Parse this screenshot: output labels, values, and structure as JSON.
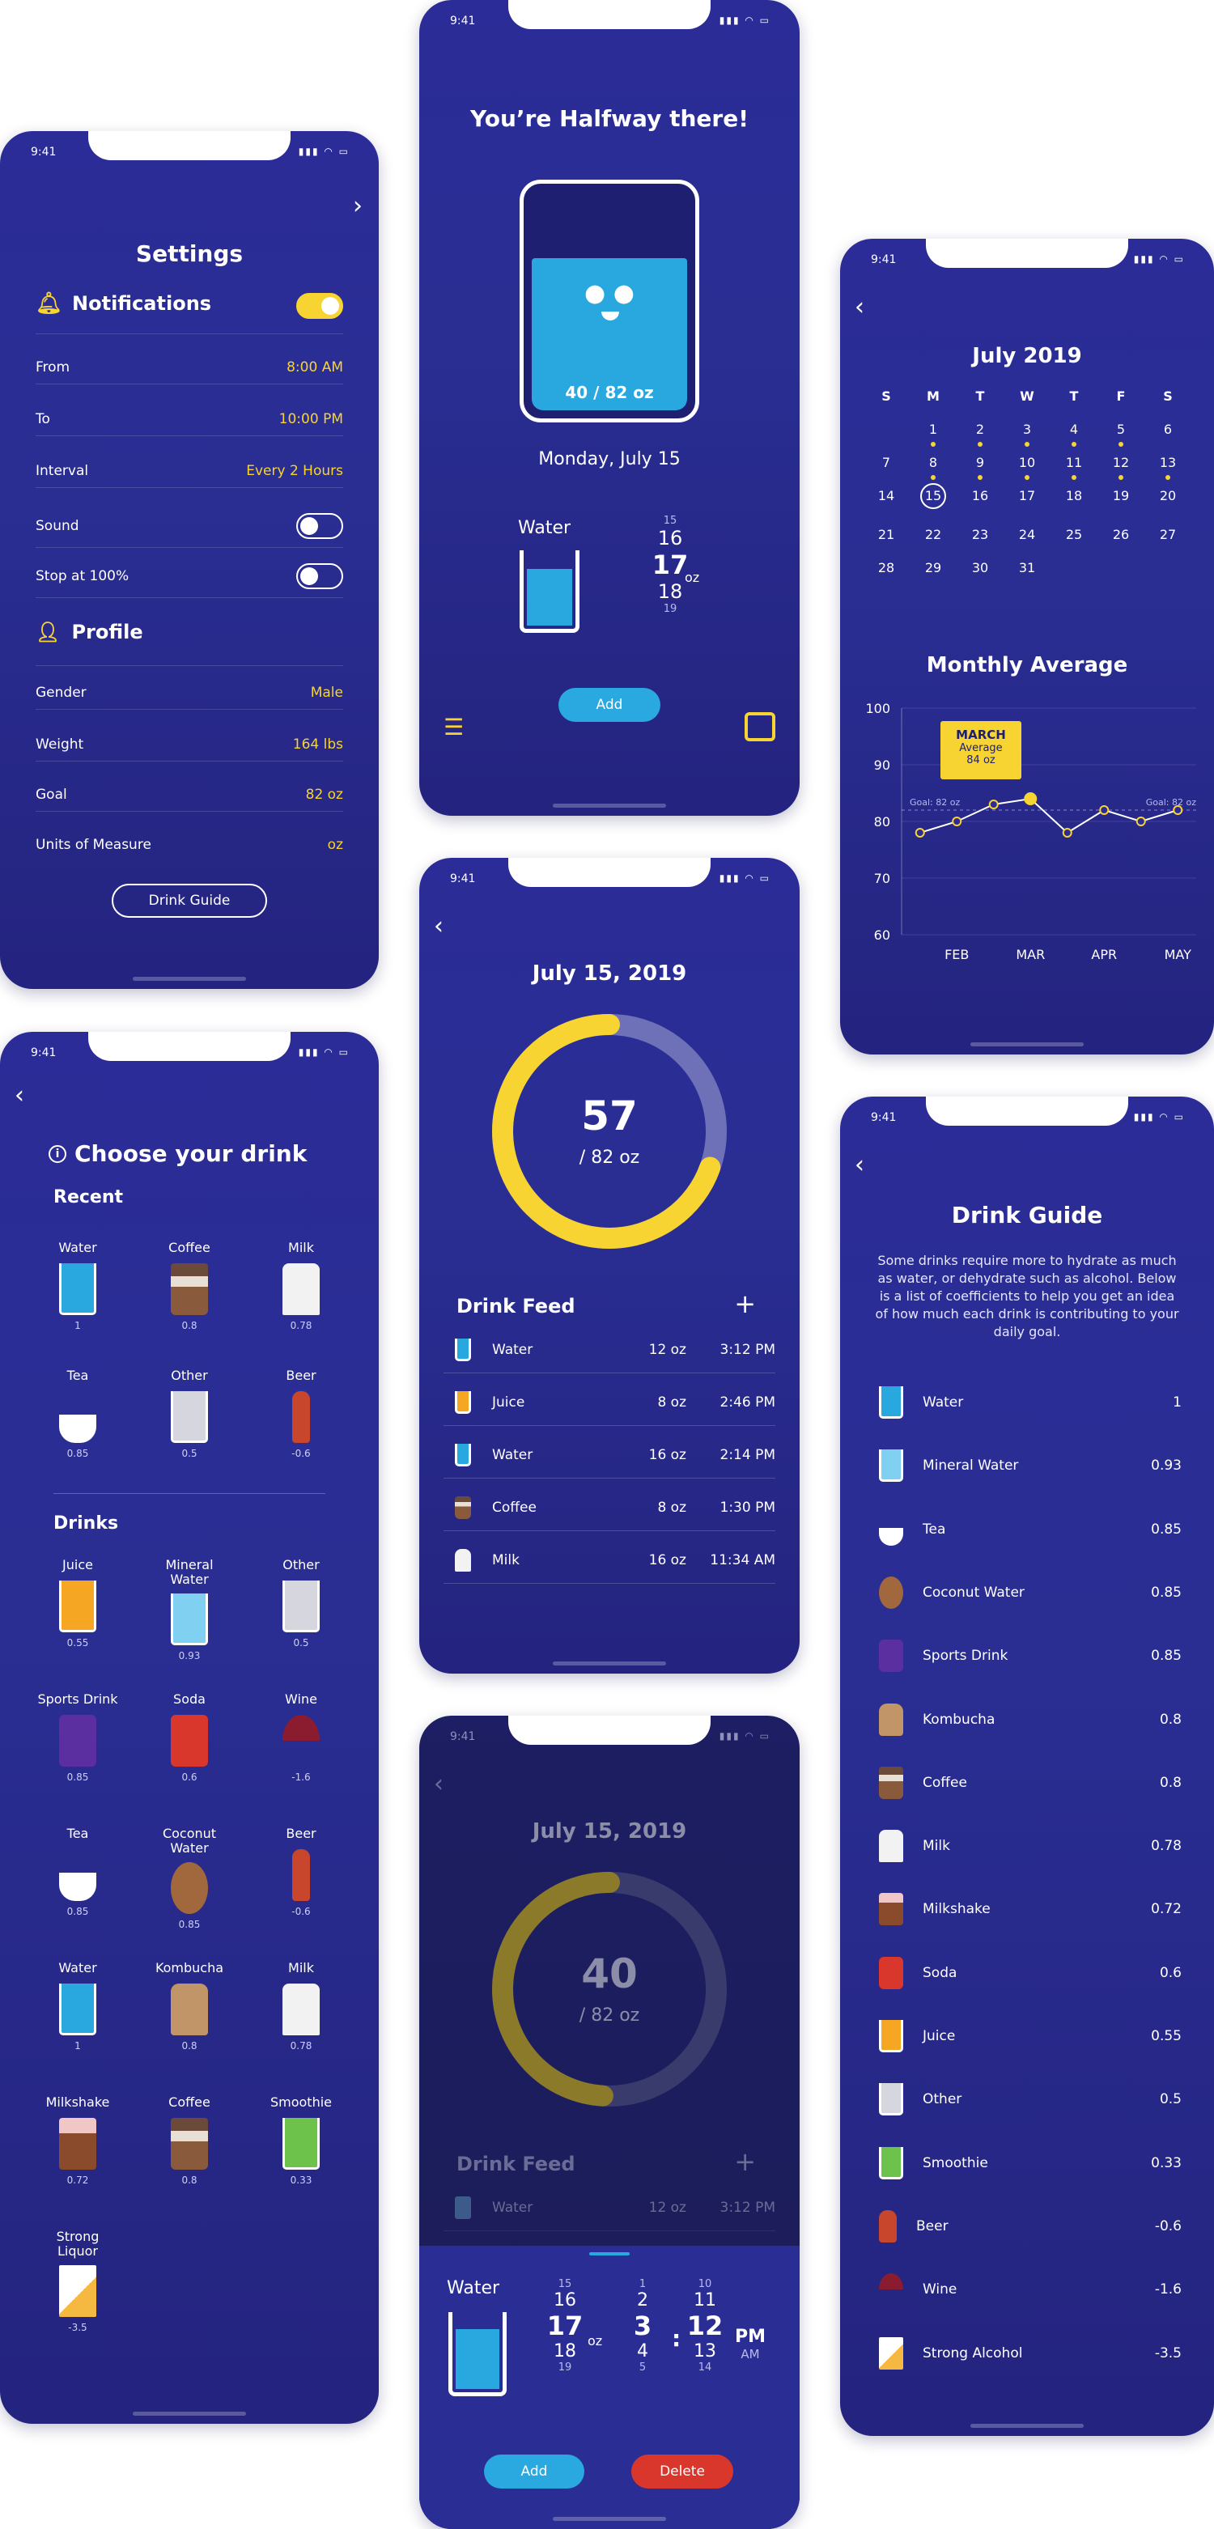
{
  "status_time": "9:41",
  "colors": {
    "accent": "#f7d431",
    "water": "#29a7df",
    "bg": "#2b2c97",
    "add": "#2aa8e0",
    "delete": "#d9362c"
  },
  "settings": {
    "title": "Settings",
    "notifications_title": "Notifications",
    "rows": [
      {
        "label": "From",
        "value": "8:00 AM"
      },
      {
        "label": "To",
        "value": "10:00 PM"
      },
      {
        "label": "Interval",
        "value": "Every 2 Hours"
      }
    ],
    "sound_label": "Sound",
    "stop_label": "Stop at 100%",
    "profile_title": "Profile",
    "profile_rows": [
      {
        "label": "Gender",
        "value": "Male"
      },
      {
        "label": "Weight",
        "value": "164 lbs"
      },
      {
        "label": "Goal",
        "value": "82 oz"
      },
      {
        "label": "Units of Measure",
        "value": "oz"
      }
    ],
    "drink_guide_button": "Drink Guide"
  },
  "home": {
    "title": "You’re Halfway there!",
    "glass_amount": "40 / 82 oz",
    "fill_fraction": 0.65,
    "date": "Monday, July 15",
    "water_label": "Water",
    "picker": [
      "15",
      "16",
      "17",
      "18",
      "19"
    ],
    "picker_unit": "oz",
    "add_button": "Add"
  },
  "calendar": {
    "month": "July 2019",
    "weekdays": [
      "S",
      "M",
      "T",
      "W",
      "T",
      "F",
      "S"
    ],
    "weeks": [
      [
        "",
        "1",
        "2",
        "3",
        "4",
        "5",
        "6"
      ],
      [
        "7",
        "8",
        "9",
        "10",
        "11",
        "12",
        "13"
      ],
      [
        "14",
        "15",
        "16",
        "17",
        "18",
        "19",
        "20"
      ],
      [
        "21",
        "22",
        "23",
        "24",
        "25",
        "26",
        "27"
      ],
      [
        "28",
        "29",
        "30",
        "31",
        "",
        "",
        ""
      ]
    ],
    "dotted_days": [
      "1",
      "2",
      "3",
      "4",
      "5",
      "8",
      "9",
      "10",
      "11",
      "12",
      "13"
    ],
    "selected_day": "15",
    "chart_title": "Monthly Average",
    "tooltip_month": "MARCH",
    "tooltip_label": "Average",
    "tooltip_value": "84 oz",
    "goal_label_left": "Goal: 82 oz",
    "goal_label_right": "Goal: 82 oz"
  },
  "chart_data": {
    "type": "line",
    "title": "Monthly Average",
    "x": [
      "",
      "FEB",
      "",
      "MAR",
      "",
      "APR",
      "",
      "MAY",
      ""
    ],
    "x_tick_labels": [
      "FEB",
      "MAR",
      "APR",
      "MAY"
    ],
    "y_ticks": [
      "100",
      "90",
      "80",
      "70",
      "60"
    ],
    "ylim": [
      60,
      100
    ],
    "series": [
      {
        "values": [
          78,
          80,
          83,
          84,
          78,
          82,
          80,
          82
        ]
      }
    ],
    "goal": 82,
    "highlight": {
      "month": "MARCH",
      "value": 84
    }
  },
  "choose": {
    "title": "Choose your drink",
    "recent_title": "Recent",
    "drinks_title": "Drinks",
    "recent": [
      {
        "name": "Water",
        "coef": "1",
        "icon": "water-glass-icon"
      },
      {
        "name": "Coffee",
        "coef": "0.8",
        "icon": "coffee-cup-icon"
      },
      {
        "name": "Milk",
        "coef": "0.78",
        "icon": "milk-carton-icon"
      },
      {
        "name": "Tea",
        "coef": "0.85",
        "icon": "tea-cup-icon"
      },
      {
        "name": "Other",
        "coef": "0.5",
        "icon": "other-glass-icon"
      },
      {
        "name": "Beer",
        "coef": "-0.6",
        "icon": "beer-bottle-icon"
      }
    ],
    "drinks": [
      {
        "name": "Juice",
        "coef": "0.55",
        "icon": "juice-glass-icon"
      },
      {
        "name": "Mineral Water",
        "coef": "0.93",
        "icon": "mineral-water-icon"
      },
      {
        "name": "Other",
        "coef": "0.5",
        "icon": "other-glass-icon"
      },
      {
        "name": "Sports Drink",
        "coef": "0.85",
        "icon": "sports-drink-can-icon"
      },
      {
        "name": "Soda",
        "coef": "0.6",
        "icon": "soda-can-icon"
      },
      {
        "name": "Wine",
        "coef": "-1.6",
        "icon": "wine-glass-icon"
      },
      {
        "name": "Tea",
        "coef": "0.85",
        "icon": "tea-cup-icon"
      },
      {
        "name": "Coconut Water",
        "coef": "0.85",
        "icon": "coconut-icon"
      },
      {
        "name": "Beer",
        "coef": "-0.6",
        "icon": "beer-bottle-icon"
      },
      {
        "name": "Water",
        "coef": "1",
        "icon": "water-glass-icon"
      },
      {
        "name": "Kombucha",
        "coef": "0.8",
        "icon": "kombucha-bottle-icon"
      },
      {
        "name": "Milk",
        "coef": "0.78",
        "icon": "milk-carton-icon"
      },
      {
        "name": "Milkshake",
        "coef": "0.72",
        "icon": "milkshake-icon"
      },
      {
        "name": "Coffee",
        "coef": "0.8",
        "icon": "coffee-cup-icon"
      },
      {
        "name": "Smoothie",
        "coef": "0.33",
        "icon": "smoothie-icon"
      },
      {
        "name": "Strong Liquor",
        "coef": "-3.5",
        "icon": "strong-liquor-icon"
      }
    ]
  },
  "progress": {
    "date": "July 15, 2019",
    "value": "57",
    "goal": "/ 82 oz",
    "fraction": 0.695,
    "feed_title": "Drink Feed",
    "feed": [
      {
        "name": "Water",
        "oz": "12 oz",
        "time": "3:12 PM",
        "icon": "water-glass-icon"
      },
      {
        "name": "Juice",
        "oz": "8 oz",
        "time": "2:46 PM",
        "icon": "juice-glass-icon"
      },
      {
        "name": "Water",
        "oz": "16 oz",
        "time": "2:14 PM",
        "icon": "water-glass-icon"
      },
      {
        "name": "Coffee",
        "oz": "8 oz",
        "time": "1:30 PM",
        "icon": "coffee-cup-icon"
      },
      {
        "name": "Milk",
        "oz": "16 oz",
        "time": "11:34 AM",
        "icon": "milk-carton-icon"
      }
    ]
  },
  "edit": {
    "date": "July 15, 2019",
    "value": "40",
    "goal": "/ 82 oz",
    "fraction": 0.49,
    "feed_title": "Drink Feed",
    "feed_row": {
      "name": "Water",
      "oz": "12 oz",
      "time": "3:12 PM"
    },
    "water_label": "Water",
    "oz_picker": [
      "15",
      "16",
      "17",
      "18",
      "19"
    ],
    "oz_unit": "oz",
    "hour_picker": [
      "1",
      "2",
      "3",
      "4",
      "5"
    ],
    "min_picker": [
      "10",
      "11",
      "12",
      "13",
      "14"
    ],
    "colon": ":",
    "ampm": [
      "PM",
      "AM"
    ],
    "add_button": "Add",
    "delete_button": "Delete"
  },
  "guide": {
    "title": "Drink Guide",
    "intro": "Some drinks require more to hydrate as much as water, or dehydrate such as alcohol. Below is a list of coefficients to help you get an idea of how much each drink is contributing to your daily goal.",
    "items": [
      {
        "name": "Water",
        "coef": "1",
        "icon": "water-glass-icon"
      },
      {
        "name": "Mineral Water",
        "coef": "0.93",
        "icon": "mineral-water-icon"
      },
      {
        "name": "Tea",
        "coef": "0.85",
        "icon": "tea-cup-icon"
      },
      {
        "name": "Coconut Water",
        "coef": "0.85",
        "icon": "coconut-icon"
      },
      {
        "name": "Sports Drink",
        "coef": "0.85",
        "icon": "sports-drink-can-icon"
      },
      {
        "name": "Kombucha",
        "coef": "0.8",
        "icon": "kombucha-bottle-icon"
      },
      {
        "name": "Coffee",
        "coef": "0.8",
        "icon": "coffee-cup-icon"
      },
      {
        "name": "Milk",
        "coef": "0.78",
        "icon": "milk-carton-icon"
      },
      {
        "name": "Milkshake",
        "coef": "0.72",
        "icon": "milkshake-icon"
      },
      {
        "name": "Soda",
        "coef": "0.6",
        "icon": "soda-can-icon"
      },
      {
        "name": "Juice",
        "coef": "0.55",
        "icon": "juice-glass-icon"
      },
      {
        "name": "Other",
        "coef": "0.5",
        "icon": "other-glass-icon"
      },
      {
        "name": "Smoothie",
        "coef": "0.33",
        "icon": "smoothie-icon"
      },
      {
        "name": "Beer",
        "coef": "-0.6",
        "icon": "beer-bottle-icon"
      },
      {
        "name": "Wine",
        "coef": "-1.6",
        "icon": "wine-glass-icon"
      },
      {
        "name": "Strong Alcohol",
        "coef": "-3.5",
        "icon": "strong-liquor-icon"
      }
    ]
  }
}
